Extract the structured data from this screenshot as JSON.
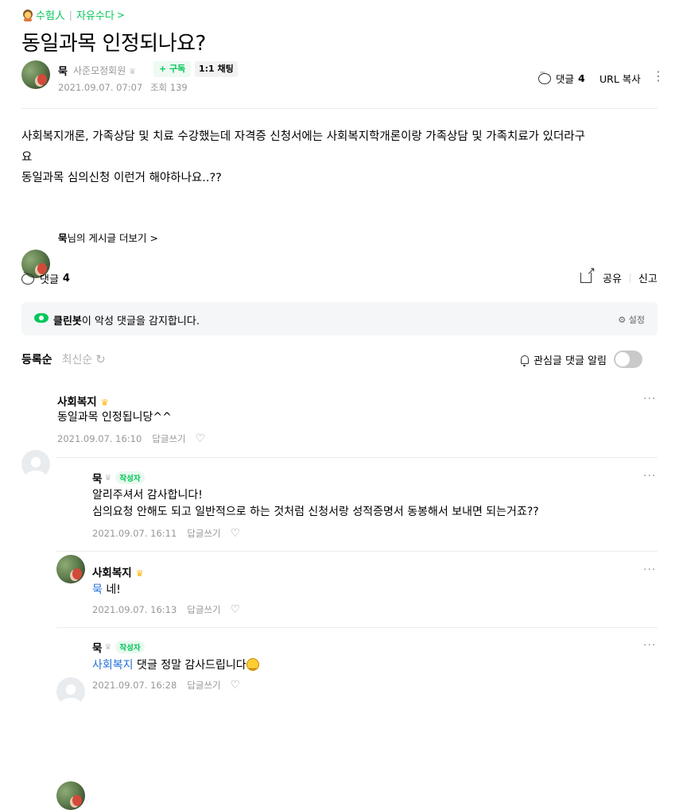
{
  "breadcrumb": {
    "board": "수험人",
    "category": "자유수다"
  },
  "post": {
    "title": "동일과목 인정되나요?",
    "author": "묵",
    "grade": "사준모정회원",
    "subscribe_label": "+ 구독",
    "chat_label": "1:1 채팅",
    "date": "2021.09.07. 07:07",
    "views_label": "조회 139",
    "comment_label": "댓글",
    "comment_count": "4",
    "url_copy_label": "URL 복사",
    "body_line1": "사회복지개론, 가족상담 및 치료 수강했는데 자격증 신청서에는 사회복지학개론이랑 가족상담 및 가족치료가 있더라구",
    "body_line2": "요",
    "body_line3": "동일과목 심의신청 이런거 해야하나요..??",
    "more_posts_name": "묵",
    "more_posts_label": "님의 게시글 더보기"
  },
  "actions": {
    "comment_label": "댓글",
    "comment_count": "4",
    "share_label": "공유",
    "report_label": "신고"
  },
  "cleanbot": {
    "name": "클린봇",
    "message": "이 악성 댓글을 감지합니다.",
    "settings_label": "설정"
  },
  "sort": {
    "active": "등록순",
    "inactive": "최신순",
    "alarm_label": "관심글 댓글 알림",
    "alarm_on": false
  },
  "comments": [
    {
      "name": "사회복지",
      "text": "동일과목 인정됩니당^^",
      "date": "2021.09.07. 16:10",
      "reply_label": "답글쓰기"
    },
    {
      "name": "묵",
      "badge": "작성자",
      "text1": "알리주셔서 감사합니다!",
      "text2": "심의요청 안해도 되고 일반적으로 하는 것처럼 신청서랑 성적증명서 동봉해서 보내면 되는거죠??",
      "date": "2021.09.07. 16:11",
      "reply_label": "답글쓰기"
    },
    {
      "name": "사회복지",
      "mention": "묵",
      "text": "네!",
      "date": "2021.09.07. 16:13",
      "reply_label": "답글쓰기"
    },
    {
      "name": "묵",
      "badge": "작성자",
      "mention": "사회복지",
      "text": "댓글 정말 감사드립니다",
      "date": "2021.09.07. 16:28",
      "reply_label": "답글쓰기"
    }
  ],
  "colors": {
    "accent": "#03c75a",
    "mention": "#1e6fd9",
    "meta": "#979797"
  }
}
